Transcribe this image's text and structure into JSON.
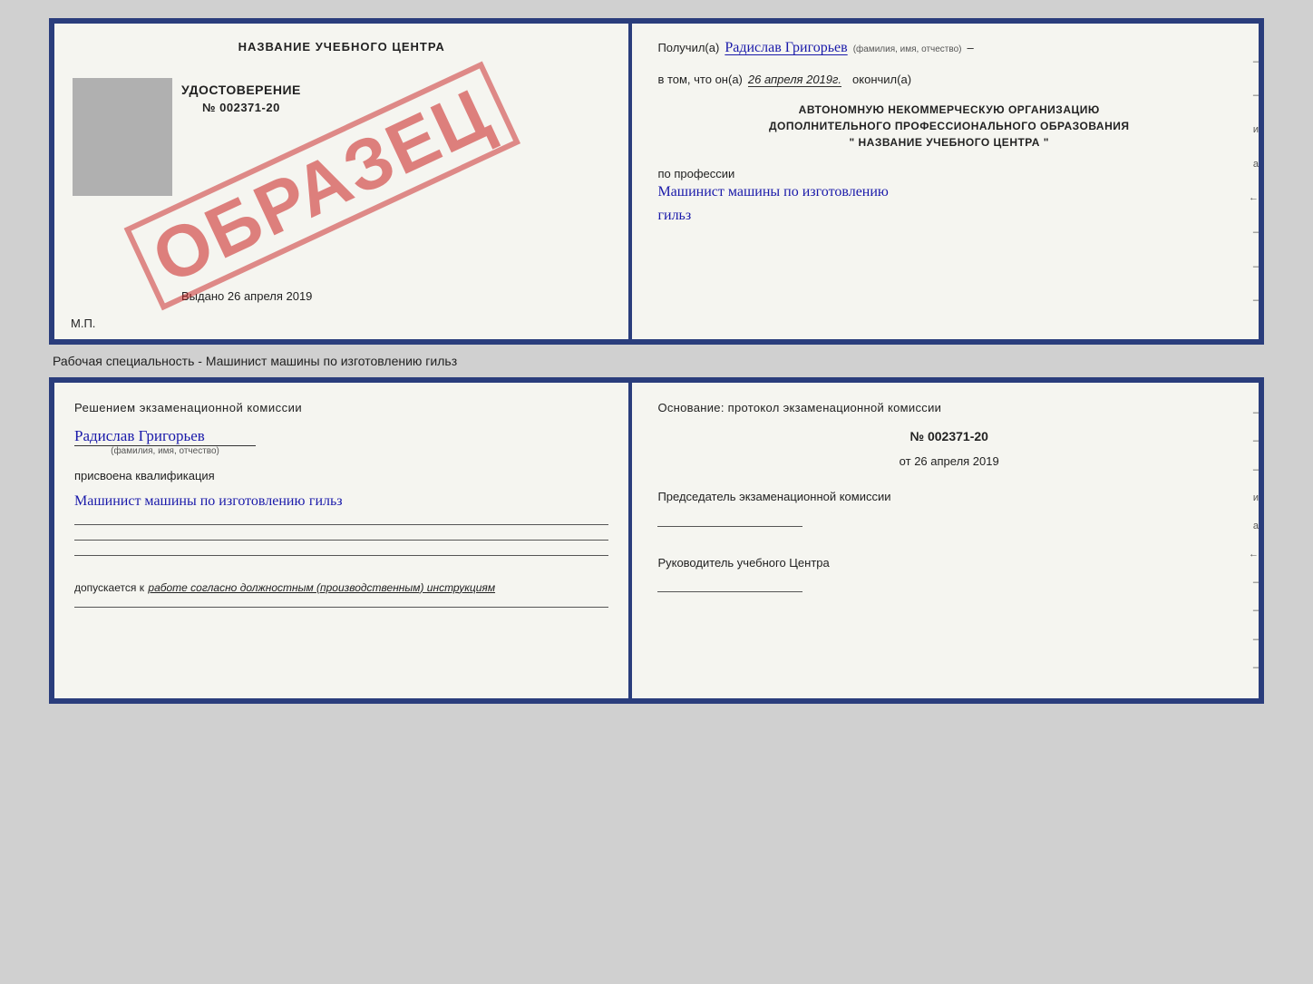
{
  "top_cert": {
    "left": {
      "school_name": "НАЗВАНИЕ УЧЕБНОГО ЦЕНТРА",
      "udostoverenie": "УДОСТОВЕРЕНИЕ",
      "number": "№ 002371-20",
      "vydano_label": "Выдано",
      "vydano_date": "26 апреля 2019",
      "mp": "М.П.",
      "stamp": "ОБРАЗЕЦ"
    },
    "right": {
      "poluchil": "Получил(а)",
      "name_hw": "Радислав Григорьев",
      "name_sublabel": "(фамилия, имя, отчество)",
      "vtom": "в том, что он(а)",
      "date": "26 апреля 2019г.",
      "okonchil": "окончил(а)",
      "org_line1": "АВТОНОМНУЮ НЕКОММЕРЧЕСКУЮ ОРГАНИЗАЦИЮ",
      "org_line2": "ДОПОЛНИТЕЛЬНОГО ПРОФЕССИОНАЛЬНОГО ОБРАЗОВАНИЯ",
      "org_line3": "\"   НАЗВАНИЕ УЧЕБНОГО ЦЕНТРА   \"",
      "po_professii": "по профессии",
      "profession_hw1": "Машинист машины по изготовлению",
      "profession_hw2": "гильз",
      "ticks": [
        "–",
        "–",
        "и",
        "а",
        "←",
        "–",
        "–",
        "–"
      ]
    }
  },
  "between_label": "Рабочая специальность - Машинист машины по изготовлению гильз",
  "bottom_cert": {
    "left": {
      "resheniyem": "Решением  экзаменационной  комиссии",
      "person_hw": "Радислав Григорьев",
      "fio_sublabel": "(фамилия, имя, отчество)",
      "prisvoena": "присвоена квалификация",
      "qualification_hw1": "Машинист машины по изготовлению",
      "qualification_hw2": "гильз",
      "dopuskaetsya_prefix": "допускается к",
      "dopuskaetsya_italic": "работе согласно должностным (производственным) инструкциям"
    },
    "right": {
      "osnovanie": "Основание: протокол экзаменационной  комиссии",
      "number": "№  002371-20",
      "ot_label": "от",
      "ot_date": "26 апреля 2019",
      "predsedatel_title": "Председатель экзаменационной комиссии",
      "rukovoditel_title": "Руководитель учебного Центра",
      "ticks": [
        "–",
        "–",
        "–",
        "и",
        "а",
        "←",
        "–",
        "–",
        "–",
        "–"
      ]
    }
  }
}
